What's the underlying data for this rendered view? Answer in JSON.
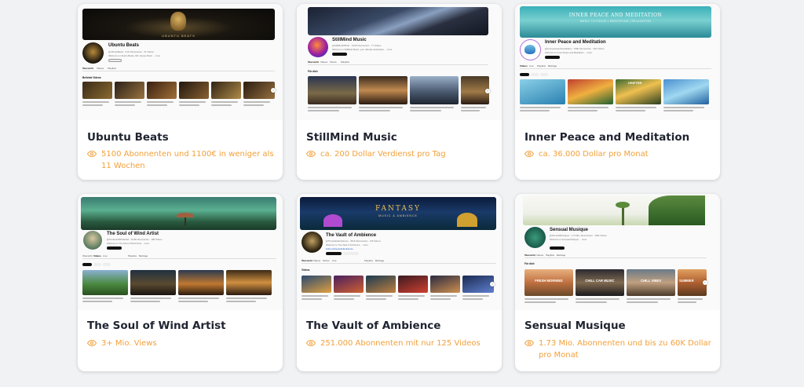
{
  "accent_color": "#f2a03a",
  "cards": [
    {
      "title": "Ubuntu Beats",
      "stat": "5100 Abonnenten und 1100€ in weniger als 11 Wochen",
      "screenshot": {
        "channel_name": "Ubuntu Beats",
        "banner_text": "UBUNTU BEATS",
        "tab_active": "Übersicht",
        "tabs": [
          "Übersicht",
          "Videos",
          "Playlists"
        ],
        "section": "Beliebte Videos"
      }
    },
    {
      "title": "StillMind Music",
      "stat": "ca. 200 Dollar Verdienst pro Tag",
      "screenshot": {
        "channel_name": "StillMind Music",
        "tab_active": "Übersicht",
        "tabs": [
          "Übersicht",
          "Videos",
          "Shorts",
          "Playlists"
        ],
        "section": "Für dich"
      }
    },
    {
      "title": "Inner Peace and Meditation",
      "stat": "ca. 36.000 Dollar pro Monat",
      "screenshot": {
        "channel_name": "Inner Peace and Meditation",
        "banner_text": "INNER PEACE AND MEDITATION",
        "banner_sub": "MUSIC TO FOCUS | MEDITATION | RELAXATION",
        "tab_active": "Videos",
        "tabs": [
          "Videos",
          "Live",
          "Playlists",
          "Beiträge"
        ],
        "thumb_label": "DRIFTER"
      }
    },
    {
      "title": "The Soul of Wind Artist",
      "stat": "3+ Mio. Views",
      "screenshot": {
        "channel_name": "The Soul of Wind Artist",
        "tab_active": "Videos",
        "tabs": [
          "Übersicht",
          "Videos",
          "Live",
          "Playlists",
          "Beiträge"
        ]
      }
    },
    {
      "title": "The Vault of Ambience",
      "stat": "251.000 Abonnenten mit nur 125 Videos",
      "screenshot": {
        "channel_name": "The Vault of Ambience",
        "banner_text": "FANTASY",
        "banner_sub": "MUSIC & AMBIENCE",
        "tab_active": "Übersicht",
        "tabs": [
          "Übersicht",
          "Videos",
          "Shorts",
          "Live",
          "Playlists",
          "Beiträge"
        ],
        "section": "Videos"
      }
    },
    {
      "title": "Sensual Musique",
      "stat": "1.73 Mio. Abonnenten und bis zu 60K Dollar pro Monat",
      "screenshot": {
        "channel_name": "Sensual Musique",
        "tab_active": "Übersicht",
        "tabs": [
          "Übersicht",
          "Videos",
          "Playlists",
          "Beiträge"
        ],
        "section": "Für dich",
        "thumb_labels": [
          "FRESH MORNING",
          "CHILL CAR MUSIC",
          "CHILL VIBES",
          "SUMMER"
        ]
      }
    }
  ]
}
